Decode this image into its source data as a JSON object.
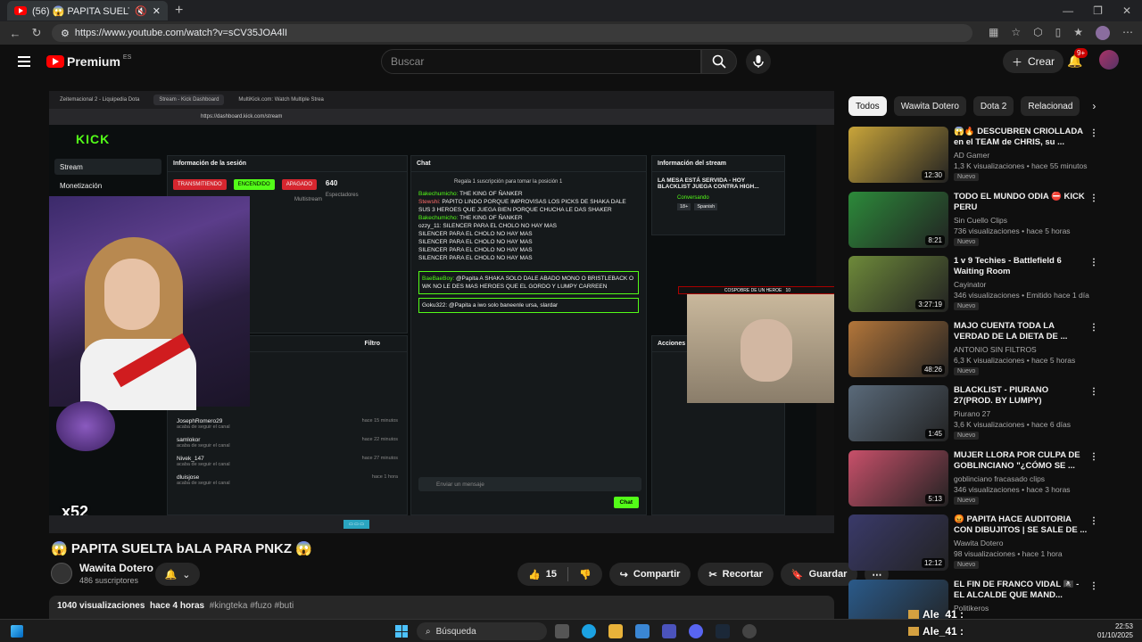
{
  "browser": {
    "tab_title": "(56) 😱 PAPITA SUELTA bALA",
    "url": "https://www.youtube.com/watch?v=sCV35JOA4lI"
  },
  "youtube": {
    "logo_text": "Premium",
    "logo_region": "ES",
    "search_placeholder": "Buscar",
    "create_label": "Crear",
    "notif_count": "9+"
  },
  "video": {
    "inner_tabs": [
      "Zeitemacional 2 - Liquipedia Dota",
      "Stream - Kick Dashboard",
      "MultiKick.com: Watch Multiple Strea"
    ],
    "inner_url": "https://dashboard.kick.com/stream",
    "kick_logo": "KICK",
    "sidebar": [
      "Stream",
      "Monetización"
    ],
    "session_header": "Información de la sesión",
    "pills": [
      "TRANSMITIENDO",
      "ENCENDIDO",
      "APAGADO"
    ],
    "viewers_value": "640",
    "viewers_label": "Espectadores",
    "multistream": "Multistream",
    "chat_header": "Chat",
    "chat_promo": "Regala 1 suscripción para tomar la posición 1",
    "chat_lines": [
      {
        "name": "Bakechumicho:",
        "text": "THE KING OF ÑANKER",
        "c": "g"
      },
      {
        "name": "Stewshi:",
        "text": "PAPITO LINDO PORQUE IMPROVISAS LOS PICKS DE SHAKA DALE SUS 3 HEROES QUE JUEGA BIEN PORQUE CHUCHA LE DAS SHAKER",
        "c": "r"
      },
      {
        "name": "Bakechumicho:",
        "text": "THE KING OF ÑANKER",
        "c": "g"
      },
      {
        "name": "ozzy_11:",
        "text": "SILENCER PARA EL CHOLO NO HAY MAS",
        "c": "n"
      },
      {
        "name": "",
        "text": "SILENCER PARA EL CHOLO NO HAY MAS",
        "c": "n"
      },
      {
        "name": "",
        "text": "SILENCER PARA EL CHOLO NO HAY MAS",
        "c": "n"
      },
      {
        "name": "",
        "text": "SILENCER PARA EL CHOLO NO HAY MAS",
        "c": "n"
      },
      {
        "name": "",
        "text": "SILENCER PARA EL CHOLO NO HAY MAS",
        "c": "n"
      }
    ],
    "highlight_name": "BaeBaeBoy:",
    "highlight_text": "@Papita A SHAKA SOLO DALE ABADO MONO O BRISTLEBACK O WK NO LE DES MAS HEROES QUE EL GORDO Y LUMPY CARREEN",
    "goku_line": "Goku322: @Papita a iwo solo baneenle ursa, slardar",
    "chat_placeholder": "Enviar un mensaje",
    "chat_button": "Chat",
    "stream_info_header": "Información del stream",
    "stream_title": "LA MESA ESTÁ SERVIDA - HOY BLACKLIST JUEGA CONTRA HIGH...",
    "stream_category": "Conversando",
    "stream_tags": [
      "18+",
      "Spanish"
    ],
    "filter_label": "Filtro",
    "follows": [
      {
        "name": "JosephRomero29",
        "sub": "acaba de seguir el canal",
        "time": "hace 15 minutos"
      },
      {
        "name": "samlokor",
        "sub": "acaba de seguir el canal",
        "time": "hace 22 minutos"
      },
      {
        "name": "Nivek_147",
        "sub": "acaba de seguir el canal",
        "time": "hace 27 minutos"
      },
      {
        "name": "dluisjose",
        "sub": "acaba de seguir el canal",
        "time": "hace 1 hora"
      }
    ],
    "actions_header": "Acciones",
    "cam2_banner": "COSPOBRE DE UN HEROE",
    "cam2_count": "10",
    "multiplier": "x52"
  },
  "title": "😱 PAPITA SUELTA bALA PARA PNKZ 😱",
  "channel": {
    "name": "Wawita Dotero",
    "subs": "486 suscriptores"
  },
  "actions": {
    "likes": "15",
    "share": "Compartir",
    "clip": "Recortar",
    "save": "Guardar"
  },
  "meta": {
    "views": "1040 visualizaciones",
    "date": "hace 4 horas",
    "tags": "#kingteka #fuzo #buti"
  },
  "chips": [
    "Todos",
    "Wawita Dotero",
    "Dota 2",
    "Relacionad"
  ],
  "recommendations": [
    {
      "title": "😱🔥 DESCUBREN CRIOLLADA en el TEAM de CHRIS, su ...",
      "channel": "AD Gamer",
      "stats": "1,3 K visualizaciones • hace 55 minutos",
      "badge": "Nuevo",
      "duration": "12:30",
      "thumb": "#c9a53a"
    },
    {
      "title": "TODO EL MUNDO ODIA ⛔ KICK PERU",
      "channel": "Sin Cuello Clips",
      "stats": "736 visualizaciones • hace 5 horas",
      "badge": "Nuevo",
      "duration": "8:21",
      "thumb": "#2c8a3a"
    },
    {
      "title": "1 v 9 Techies - Battlefield 6 Waiting Room",
      "channel": "Cayinator",
      "stats": "346 visualizaciones • Emitido hace 1 día",
      "badge": "Nuevo",
      "duration": "3:27:19",
      "thumb": "#6e8a3a"
    },
    {
      "title": "MAJO CUENTA TODA LA VERDAD DE LA DIETA DE ...",
      "channel": "ANTONIO SIN FILTROS",
      "stats": "6,3 K visualizaciones • hace 5 horas",
      "badge": "Nuevo",
      "duration": "48:26",
      "thumb": "#b3763a"
    },
    {
      "title": "BLACKLIST - PIURANO 27(PROD. BY LUMPY)",
      "channel": "Piurano 27",
      "stats": "3,6 K visualizaciones • hace 6 días",
      "badge": "Nuevo",
      "duration": "1:45",
      "thumb": "#5a6a7a"
    },
    {
      "title": "MUJER LLORA POR CULPA DE GOBLINCIANO \"¿CÓMO SE ...",
      "channel": "goblinciano fracasado clips",
      "stats": "346 visualizaciones • hace 3 horas",
      "badge": "Nuevo",
      "duration": "5:13",
      "thumb": "#c8506a"
    },
    {
      "title": "😡 PAPITA HACE AUDITORIA CON DIBUJITOS | SE SALE DE ...",
      "channel": "Wawita Dotero",
      "stats": "98 visualizaciones • hace 1 hora",
      "badge": "Nuevo",
      "duration": "12:12",
      "thumb": "#3a3a6a"
    },
    {
      "title": "EL FIN DE FRANCO VIDAL 🏴‍☠️ - EL ALCALDE QUE MAND...",
      "channel": "Politikeros",
      "stats": "",
      "badge": "",
      "duration": "",
      "thumb": "#2a5a8a"
    }
  ],
  "overlay_user": "Ale_41 :",
  "taskbar": {
    "search": "Búsqueda",
    "time": "22:53",
    "date": "01/10/2025"
  }
}
